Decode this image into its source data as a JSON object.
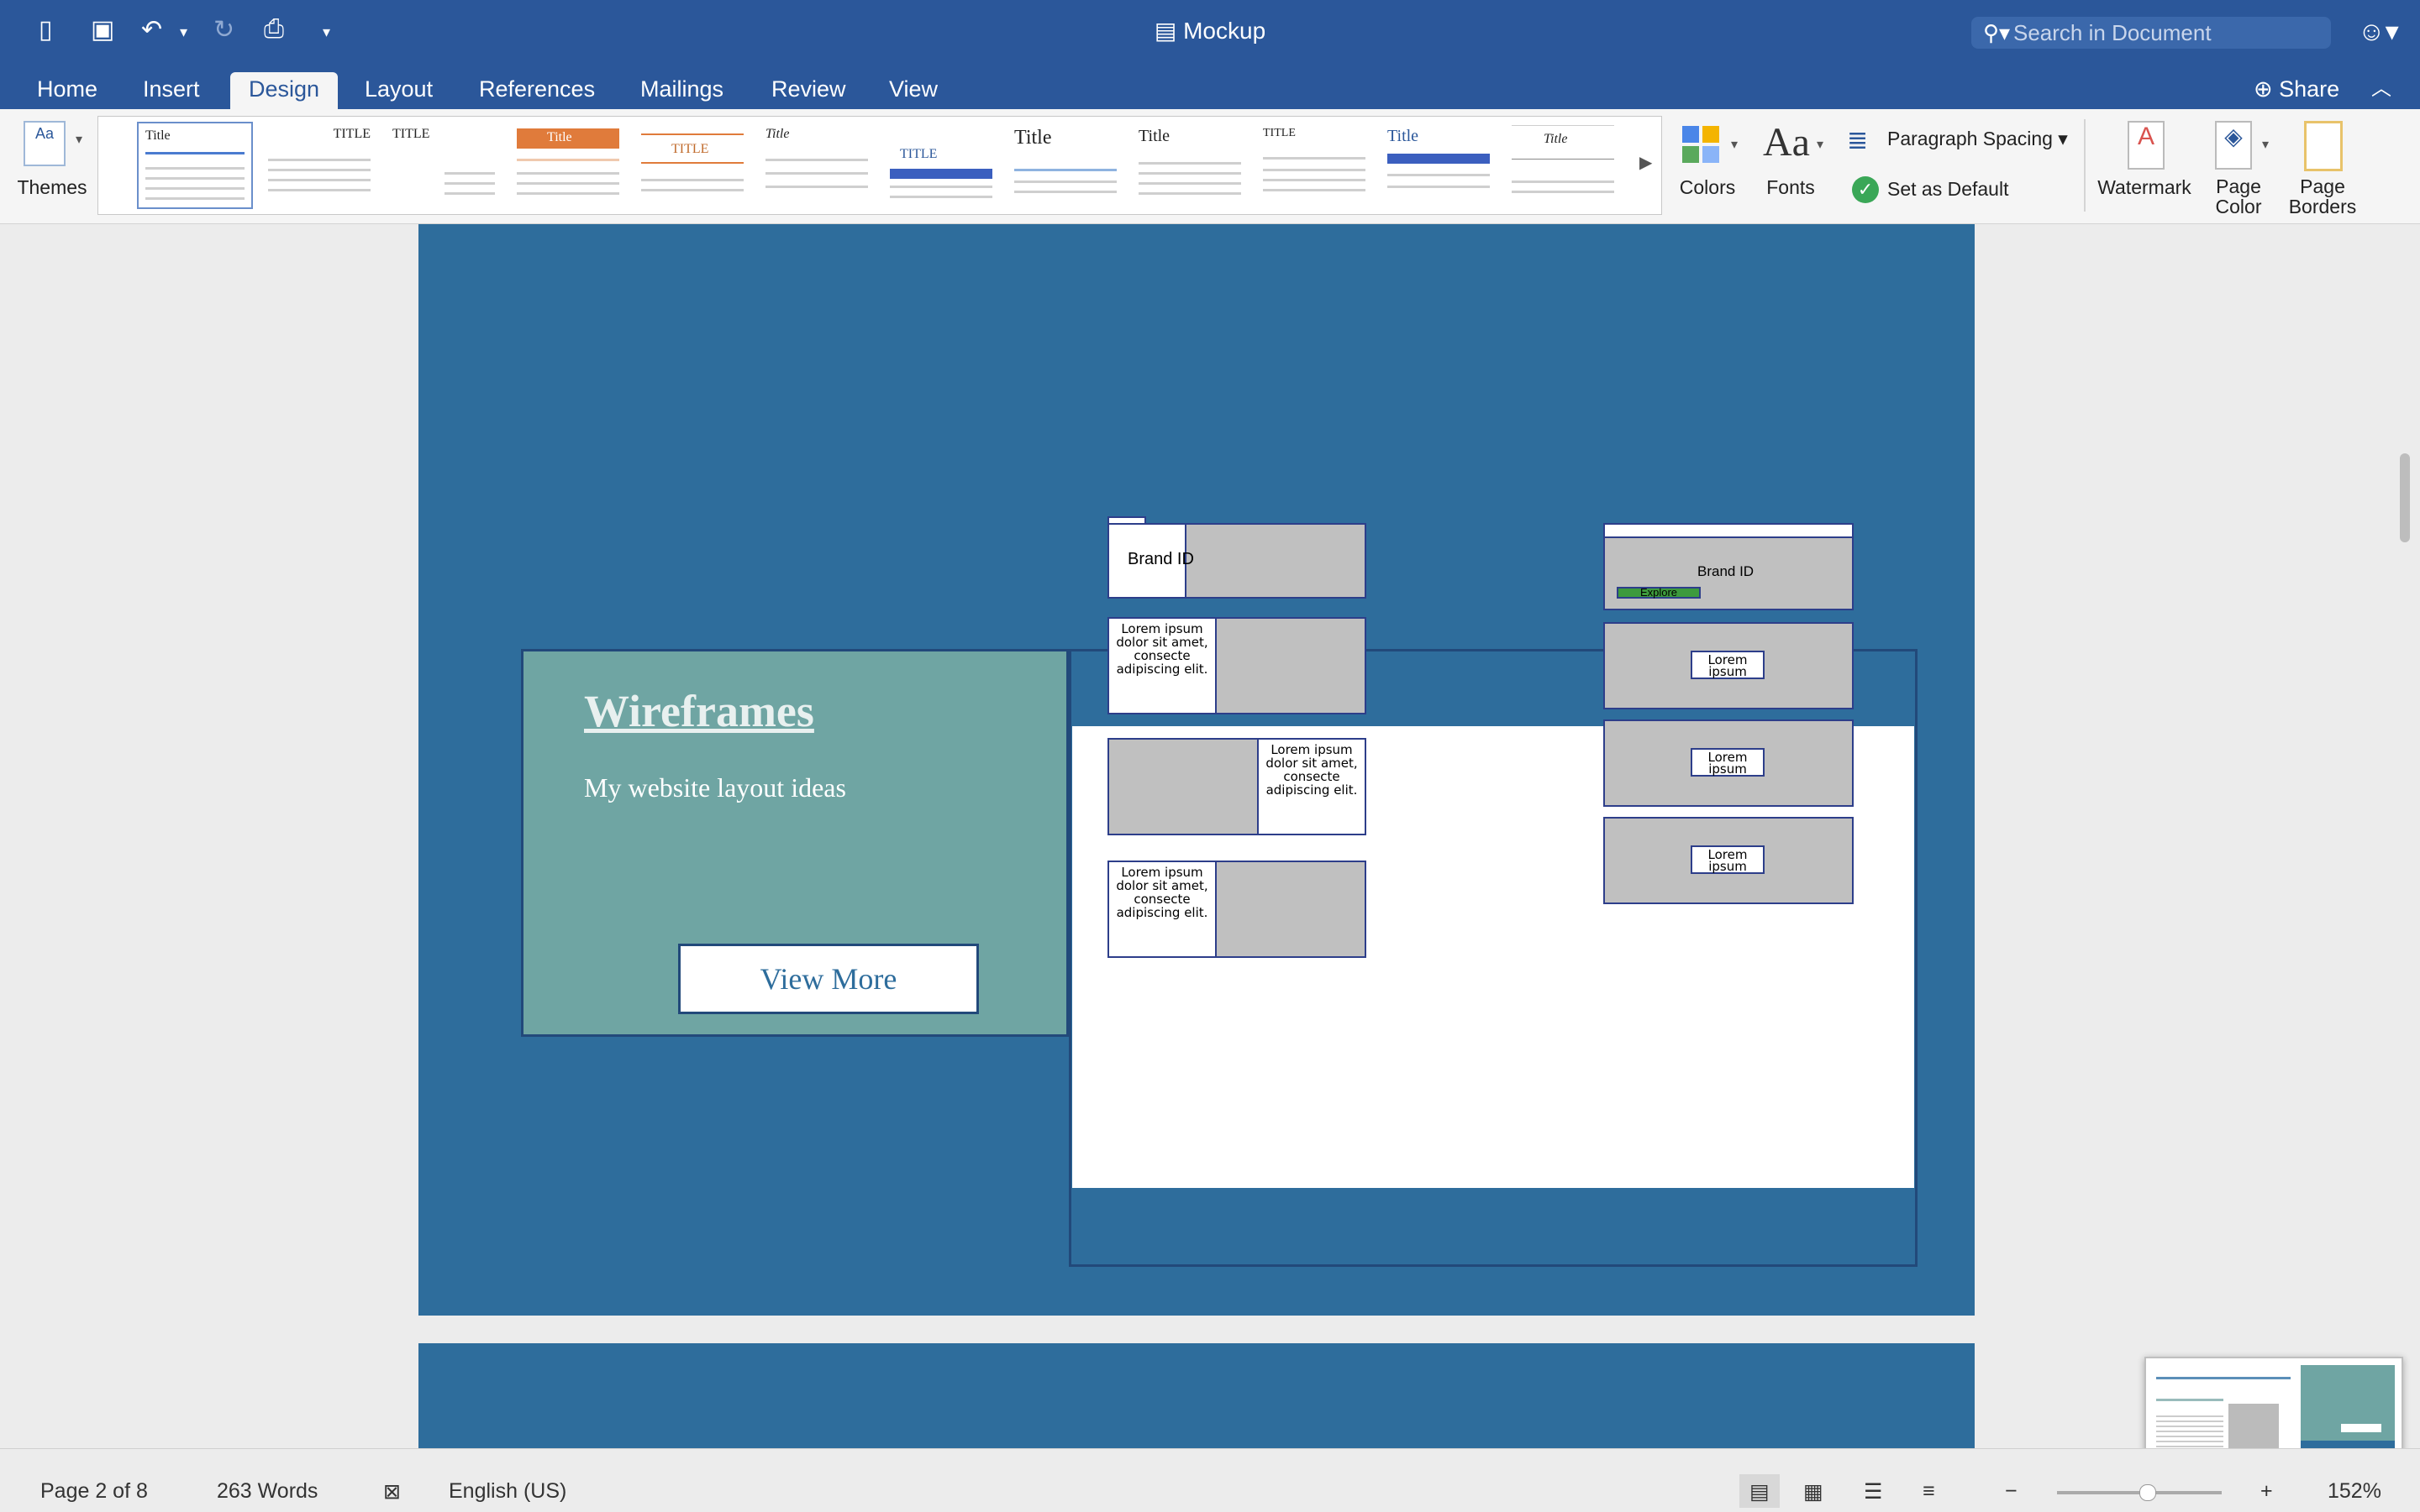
{
  "window": {
    "title": "Mockup",
    "search_placeholder": "Search in Document"
  },
  "tabs": [
    "Home",
    "Insert",
    "Design",
    "Layout",
    "References",
    "Mailings",
    "Review",
    "View"
  ],
  "active_tab": "Design",
  "share_label": "Share",
  "ribbon": {
    "themes_label": "Themes",
    "colors_label": "Colors",
    "fonts_label": "Fonts",
    "paragraph_spacing_label": "Paragraph Spacing",
    "set_as_default_label": "Set as Default",
    "watermark_label": "Watermark",
    "page_color_label": "Page\nColor",
    "page_borders_label": "Page\nBorders",
    "style_thumb_titles": [
      "Title",
      "TITLE",
      "TITLE",
      "Title",
      "TITLE",
      "Title",
      "TITLE",
      "Title",
      "Title",
      "TITLE",
      "Title",
      "Title"
    ]
  },
  "document": {
    "wireframes_title": "Wireframes",
    "subtitle": "My website layout ideas",
    "view_more": "View More",
    "brand_id": "Brand ID",
    "explore": "Explore",
    "lorem_long": "Lorem ipsum dolor sit amet, consecte adipiscing elit.",
    "lorem_short": "Lorem ipsum"
  },
  "status": {
    "page": "Page 2 of 8",
    "words": "263 Words",
    "language": "English (US)",
    "zoom": "152%"
  },
  "colors": {
    "brand": "#2b579a",
    "page_bg": "#2e6d9c",
    "panel": "#6fa5a3"
  }
}
